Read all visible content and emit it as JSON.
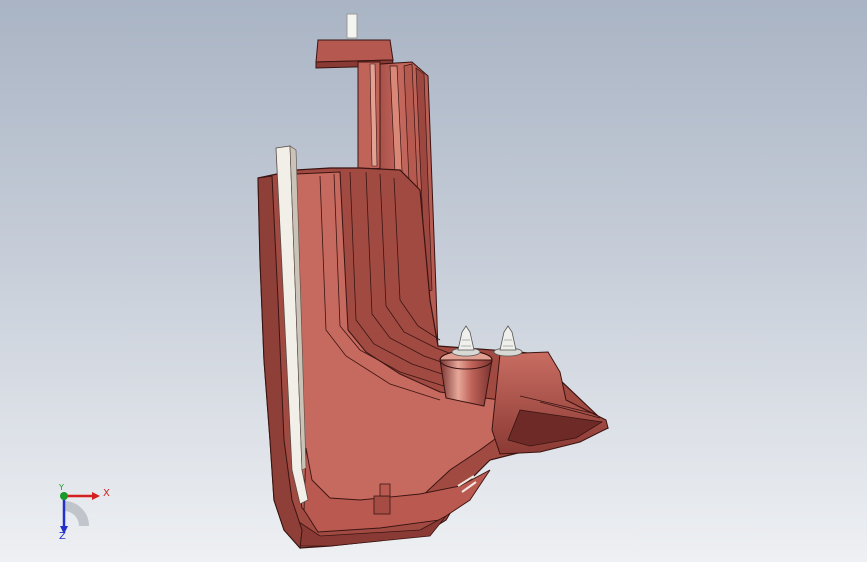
{
  "viewport": {
    "background_top": "#a9b4c4",
    "background_bottom": "#eef0f3"
  },
  "model": {
    "part_color": "#c0645a",
    "part_shadow": "#8a3a34",
    "part_highlight": "#d98878",
    "edge_color": "#3a1412",
    "pin_color": "#f2f2ee"
  },
  "triad": {
    "x_label": "X",
    "y_label": "Y",
    "z_label": "Z",
    "x_color": "#d42020",
    "y_color": "#1a9a2a",
    "z_color": "#2030c8"
  }
}
